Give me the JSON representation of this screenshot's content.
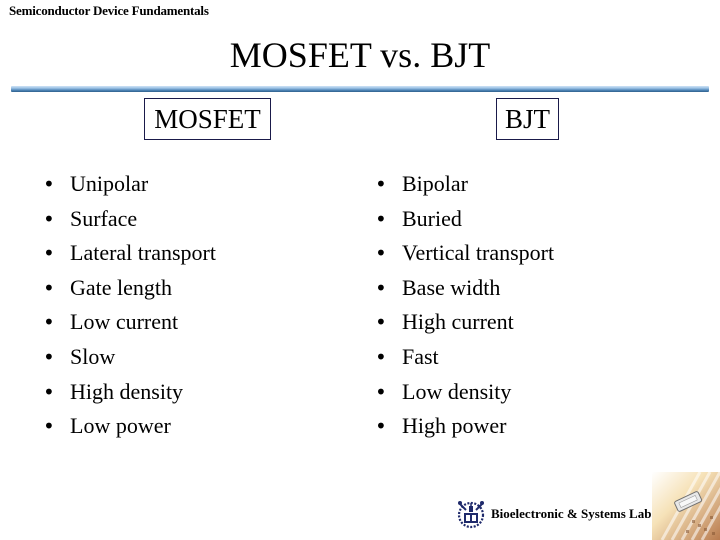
{
  "header": {
    "course_title": "Semiconductor Device Fundamentals"
  },
  "slide": {
    "title": "MOSFET vs. BJT"
  },
  "columns": {
    "left": {
      "heading": "MOSFET",
      "items": [
        "Unipolar",
        "Surface",
        "Lateral transport",
        "Gate length",
        "Low current",
        "Slow",
        "High density",
        "Low power"
      ]
    },
    "right": {
      "heading": "BJT",
      "items": [
        "Bipolar",
        "Buried",
        "Vertical transport",
        "Base width",
        "High current",
        "Fast",
        "Low density",
        "High power"
      ]
    }
  },
  "bullet_glyph": "•",
  "footer": {
    "lab_name": "Bioelectronic & Systems Lab.",
    "logo_icon": "university-emblem-icon",
    "decor_image": "semiconductor-chip-image"
  },
  "colors": {
    "rule_gradient_top": "#cfe2f5",
    "rule_gradient_bottom": "#2e5f8c",
    "box_border": "#1a1a4a",
    "emblem": "#1f2a6b"
  }
}
